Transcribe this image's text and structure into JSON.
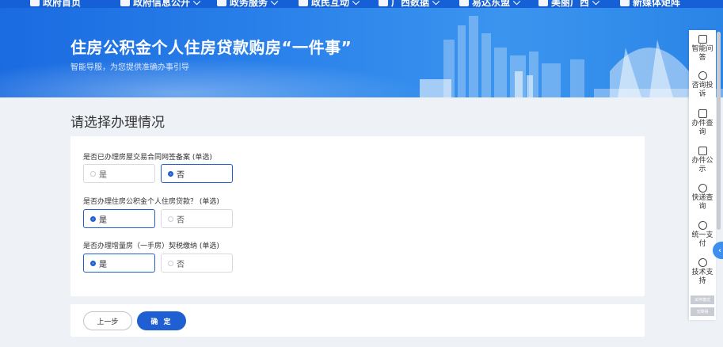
{
  "nav": {
    "items": [
      {
        "label": "政府首页",
        "icon": "home-icon"
      },
      {
        "label": "政府信息公开",
        "icon": "info-icon",
        "caret": "⌵"
      },
      {
        "label": "政务服务",
        "icon": "service-icon",
        "caret": "⌵"
      },
      {
        "label": "政民互动",
        "icon": "interact-icon",
        "caret": "⌵"
      },
      {
        "label": "广西数据",
        "icon": "data-icon",
        "caret": "⌵"
      },
      {
        "label": "易达东盟",
        "icon": "asean-icon",
        "caret": "⌵"
      },
      {
        "label": "美丽广西",
        "icon": "scenery-icon",
        "caret": "⌵"
      },
      {
        "label": "新媒体矩阵",
        "icon": "media-icon"
      }
    ]
  },
  "banner": {
    "title": "住房公积金个人住房贷款购房“一件事”",
    "subtitle": "智能导服，为您提供准确办事引导"
  },
  "main": {
    "section_title": "请选择办理情况",
    "questions": [
      {
        "label": "是否已办理房屋交易合同网签备案 (单选)",
        "options": [
          "是",
          "否"
        ],
        "selected": 1
      },
      {
        "label": "是否办理住房公积金个人住房贷款？ (单选)",
        "options": [
          "是",
          "否"
        ],
        "selected": 0
      },
      {
        "label": "是否办理增量房（一手房）契税缴纳 (单选)",
        "options": [
          "是",
          "否"
        ],
        "selected": 0
      }
    ],
    "actions": {
      "prev": "上一步",
      "ok": "确 定"
    }
  },
  "sidebar": {
    "items": [
      {
        "label": "智能问答",
        "icon": "robot-icon"
      },
      {
        "label": "咨询投诉",
        "icon": "chat-icon"
      },
      {
        "label": "办件查询",
        "icon": "document-search-icon"
      },
      {
        "label": "办件公示",
        "icon": "home-outline-icon"
      },
      {
        "label": "快递查询",
        "icon": "package-icon"
      },
      {
        "label": "统一支付",
        "icon": "yen-icon"
      },
      {
        "label": "技术支持",
        "icon": "headset-icon"
      }
    ],
    "mini1": "关怀模式",
    "mini2": "无障碍",
    "collapse_glyph": "‹"
  }
}
